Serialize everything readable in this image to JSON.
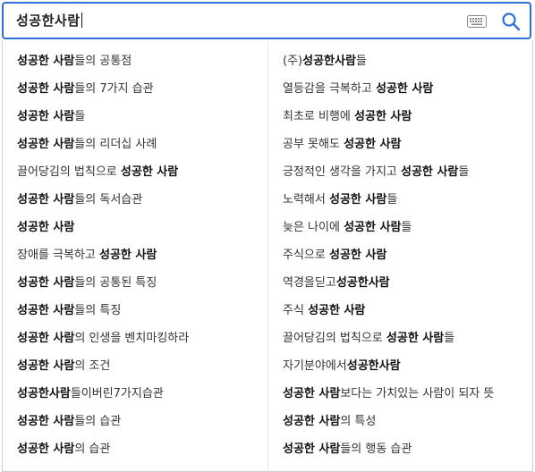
{
  "search": {
    "query": "성공한사람"
  },
  "suggestions": {
    "left": [
      [
        {
          "t": "성공한 사람",
          "b": true
        },
        {
          "t": "들의 공통점",
          "b": false
        }
      ],
      [
        {
          "t": "성공한 사람",
          "b": true
        },
        {
          "t": "들의 7가지 습관",
          "b": false
        }
      ],
      [
        {
          "t": "성공한 사람",
          "b": true
        },
        {
          "t": "들",
          "b": false
        }
      ],
      [
        {
          "t": "성공한 사람",
          "b": true
        },
        {
          "t": "들의 리더십 사례",
          "b": false
        }
      ],
      [
        {
          "t": "끌어당김의 법칙으로 ",
          "b": false
        },
        {
          "t": "성공한 사람",
          "b": true
        }
      ],
      [
        {
          "t": "성공한 사람",
          "b": true
        },
        {
          "t": "들의 독서습관",
          "b": false
        }
      ],
      [
        {
          "t": "성공한 사람",
          "b": true
        }
      ],
      [
        {
          "t": "장애를 극복하고 ",
          "b": false
        },
        {
          "t": "성공한 사람",
          "b": true
        }
      ],
      [
        {
          "t": "성공한 사람",
          "b": true
        },
        {
          "t": "들의 공통된 특징",
          "b": false
        }
      ],
      [
        {
          "t": "성공한 사람",
          "b": true
        },
        {
          "t": "들의 특징",
          "b": false
        }
      ],
      [
        {
          "t": "성공한 사람",
          "b": true
        },
        {
          "t": "의 인생을 벤치마킹하라",
          "b": false
        }
      ],
      [
        {
          "t": "성공한 사람",
          "b": true
        },
        {
          "t": "의 조건",
          "b": false
        }
      ],
      [
        {
          "t": "성공한사람",
          "b": true
        },
        {
          "t": "들이버린7가지습관",
          "b": false
        }
      ],
      [
        {
          "t": "성공한 사람",
          "b": true
        },
        {
          "t": "들의 습관",
          "b": false
        }
      ],
      [
        {
          "t": "성공한 사람",
          "b": true
        },
        {
          "t": "의 습관",
          "b": false
        }
      ]
    ],
    "right": [
      [
        {
          "t": "(주)",
          "b": false
        },
        {
          "t": "성공한사람",
          "b": true
        },
        {
          "t": "들",
          "b": false
        }
      ],
      [
        {
          "t": "열등감을 극복하고 ",
          "b": false
        },
        {
          "t": "성공한 사람",
          "b": true
        }
      ],
      [
        {
          "t": "최초로 비행에 ",
          "b": false
        },
        {
          "t": "성공한 사람",
          "b": true
        }
      ],
      [
        {
          "t": "공부 못해도 ",
          "b": false
        },
        {
          "t": "성공한 사람",
          "b": true
        }
      ],
      [
        {
          "t": "긍정적인 생각을 가지고 ",
          "b": false
        },
        {
          "t": "성공한 사람",
          "b": true
        },
        {
          "t": "들",
          "b": false
        }
      ],
      [
        {
          "t": "노력해서 ",
          "b": false
        },
        {
          "t": "성공한 사람",
          "b": true
        },
        {
          "t": "들",
          "b": false
        }
      ],
      [
        {
          "t": "늦은 나이에 ",
          "b": false
        },
        {
          "t": "성공한 사람",
          "b": true
        },
        {
          "t": "들",
          "b": false
        }
      ],
      [
        {
          "t": "주식으로 ",
          "b": false
        },
        {
          "t": "성공한 사람",
          "b": true
        }
      ],
      [
        {
          "t": "역경을딛고",
          "b": false
        },
        {
          "t": "성공한사람",
          "b": true
        }
      ],
      [
        {
          "t": "주식 ",
          "b": false
        },
        {
          "t": "성공한 사람",
          "b": true
        }
      ],
      [
        {
          "t": "끌어당김의 법칙으로 ",
          "b": false
        },
        {
          "t": "성공한 사람",
          "b": true
        },
        {
          "t": "들",
          "b": false
        }
      ],
      [
        {
          "t": "자기분야에서",
          "b": false
        },
        {
          "t": "성공한사람",
          "b": true
        }
      ],
      [
        {
          "t": "성공한 사람",
          "b": true
        },
        {
          "t": "보다는 가치있는 사람이 되자 뜻",
          "b": false
        }
      ],
      [
        {
          "t": "성공한 사람",
          "b": true
        },
        {
          "t": "의 특성",
          "b": false
        }
      ],
      [
        {
          "t": "성공한 사람",
          "b": true
        },
        {
          "t": "들의 행동 습관",
          "b": false
        }
      ]
    ]
  },
  "icons": {
    "keyboard": "keyboard-icon",
    "search": "search-icon",
    "search_color": "#2f6fd6"
  }
}
